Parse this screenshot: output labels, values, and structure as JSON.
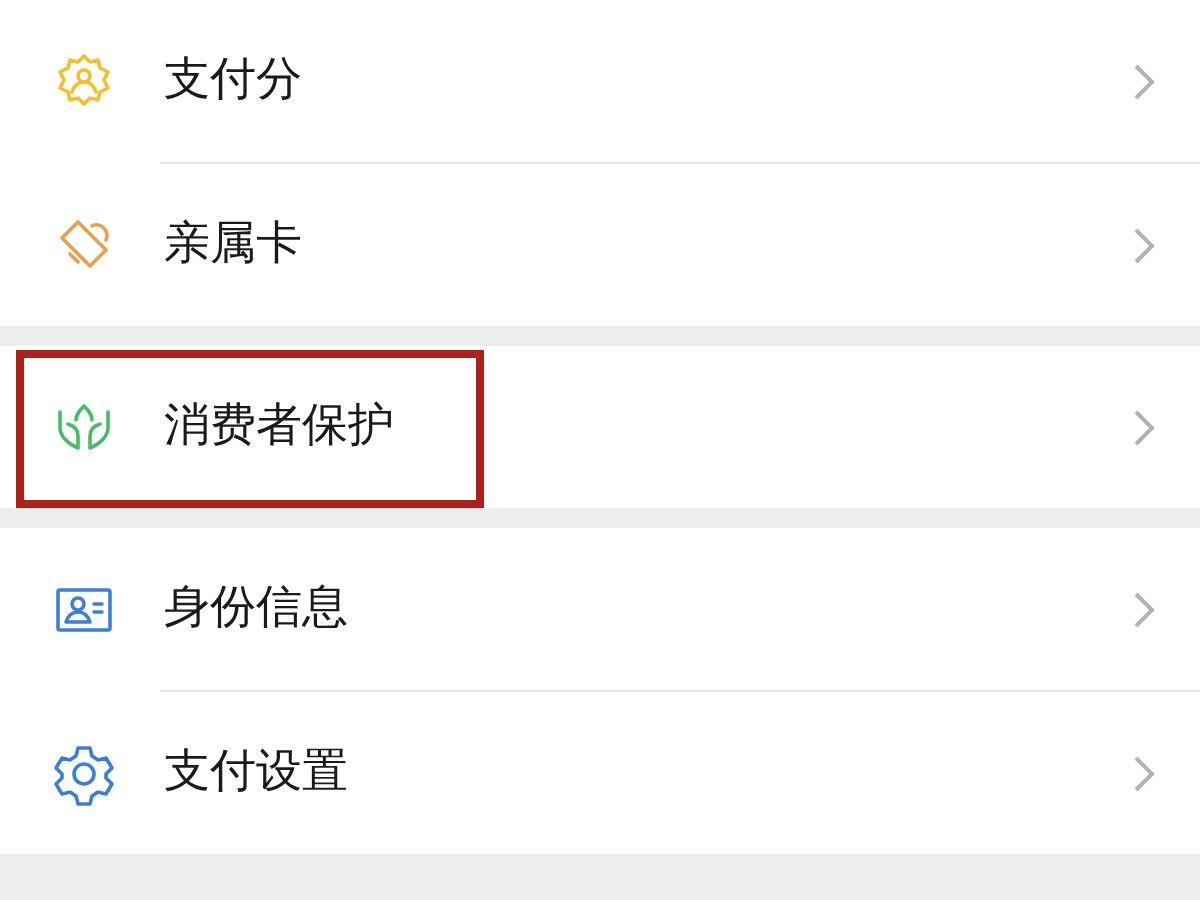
{
  "groups": [
    {
      "items": [
        {
          "kind": "badge",
          "label": "支付分",
          "highlighted": false
        },
        {
          "kind": "card",
          "label": "亲属卡",
          "highlighted": false
        }
      ]
    },
    {
      "items": [
        {
          "kind": "hands",
          "label": "消费者保护",
          "highlighted": true
        }
      ]
    },
    {
      "items": [
        {
          "kind": "idcard",
          "label": "身份信息",
          "highlighted": false
        },
        {
          "kind": "gear",
          "label": "支付设置",
          "highlighted": false
        }
      ]
    }
  ]
}
